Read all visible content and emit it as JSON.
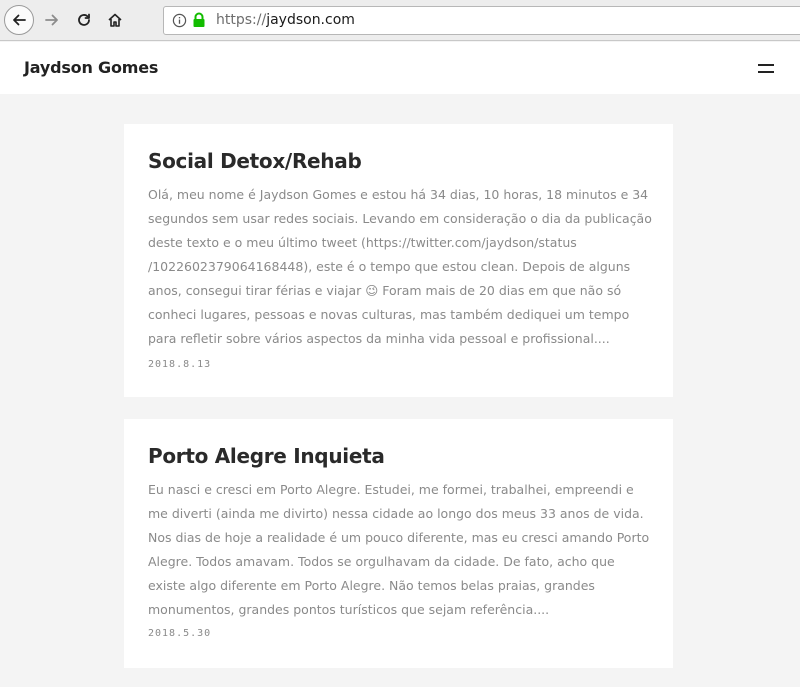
{
  "browser": {
    "url_prefix": "https://",
    "url_domain": "jaydson.com"
  },
  "site": {
    "title": "Jaydson Gomes",
    "menu_icon": "hamburger-menu-icon"
  },
  "posts": [
    {
      "title": "Social Detox/Rehab",
      "excerpt": "Olá, meu nome é Jaydson Gomes e estou há 34 dias, 10 horas, 18 minutos e 34 segundos sem usar redes sociais. Levando em consideração o dia da publicação deste texto e o meu último tweet (https://twitter.com/jaydson/status /1022602379064168448), este é o tempo que estou clean. Depois de alguns anos, consegui tirar férias e viajar 😉 Foram mais de 20 dias em que não só conheci lugares, pessoas e novas culturas, mas também dediquei um tempo para refletir sobre vários aspectos da minha vida pessoal e profissional....",
      "date": "2018.8.13"
    },
    {
      "title": "Porto Alegre Inquieta",
      "excerpt": "Eu nasci e cresci em Porto Alegre. Estudei, me formei, trabalhei, empreendi e me diverti (ainda me divirto) nessa cidade ao longo dos meus 33 anos de vida. Nos dias de hoje a realidade é um pouco diferente, mas eu cresci amando Porto Alegre. Todos amavam. Todos se orgulhavam da cidade. De fato, acho que existe algo diferente em Porto Alegre. Não temos belas praias, grandes monumentos, grandes pontos turísticos que sejam referência....",
      "date": "2018.5.30"
    }
  ]
}
